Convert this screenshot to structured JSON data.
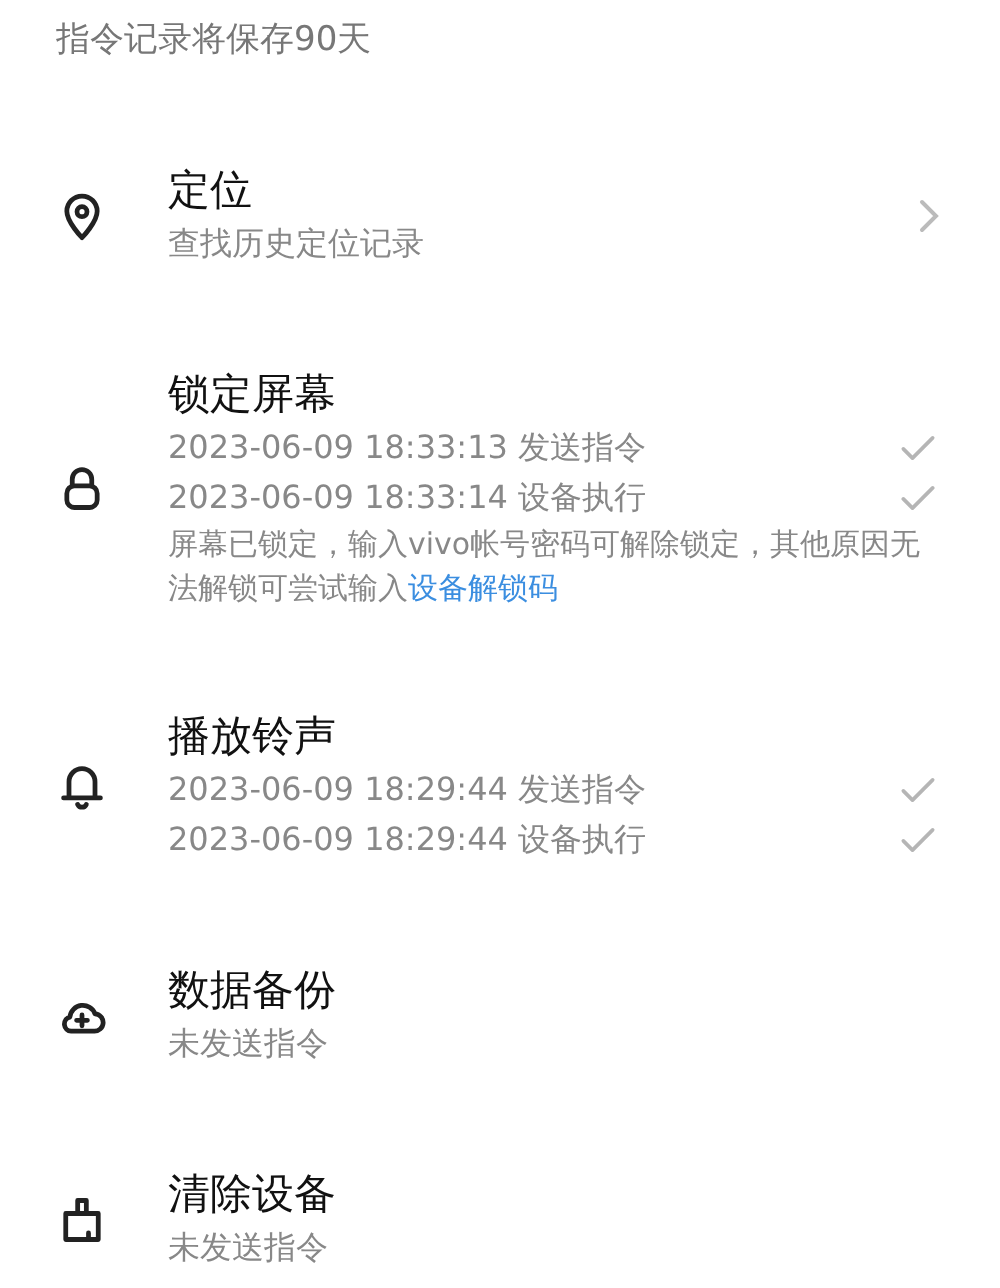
{
  "notice": "指令记录将保存90天",
  "commands": [
    {
      "kind": "pin",
      "title": "定位",
      "subtitle": "查找历史定位记录",
      "has_arrow": true
    },
    {
      "kind": "lock",
      "title": "锁定屏幕",
      "log": [
        {
          "text": "2023-06-09 18:33:13 发送指令",
          "done": true
        },
        {
          "text": "2023-06-09 18:33:14 设备执行",
          "done": true
        }
      ],
      "note": {
        "text": "屏幕已锁定，输入vivo帐号密码可解除锁定，其他原因无法解锁可尝试输入",
        "link": "设备解锁码"
      }
    },
    {
      "kind": "bell",
      "title": "播放铃声",
      "log": [
        {
          "text": "2023-06-09 18:29:44 发送指令",
          "done": true
        },
        {
          "text": "2023-06-09 18:29:44 设备执行",
          "done": true
        }
      ]
    },
    {
      "kind": "cloud",
      "title": "数据备份",
      "subtitle": "未发送指令"
    },
    {
      "kind": "brush",
      "title": "清除设备",
      "subtitle": "未发送指令"
    }
  ]
}
